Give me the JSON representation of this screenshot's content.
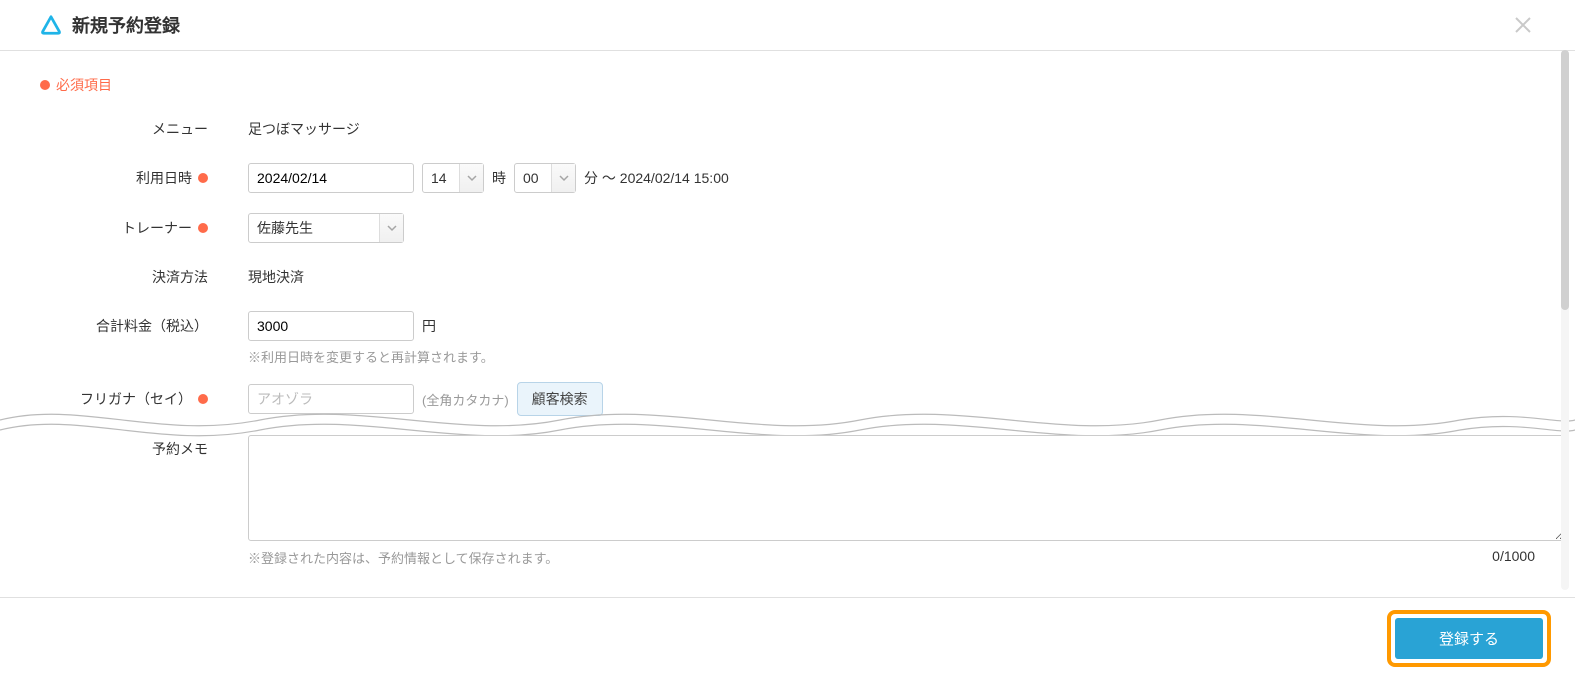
{
  "header": {
    "title": "新規予約登録"
  },
  "legend": {
    "required_label": "必須項目"
  },
  "form": {
    "menu": {
      "label": "メニュー",
      "value": "足つぼマッサージ"
    },
    "datetime": {
      "label": "利用日時",
      "date_value": "2024/02/14",
      "hour_selected": "14",
      "hour_unit": "時",
      "minute_selected": "00",
      "minute_unit_text": "分 〜 2024/02/14 15:00"
    },
    "trainer": {
      "label": "トレーナー",
      "selected": "佐藤先生"
    },
    "payment": {
      "label": "決済方法",
      "value": "現地決済"
    },
    "price": {
      "label": "合計料金（税込）",
      "value": "3000",
      "unit": "円",
      "help": "※利用日時を変更すると再計算されます。"
    },
    "furigana_sei": {
      "label": "フリガナ（セイ）",
      "placeholder": "アオゾラ",
      "hint": "(全角カタカナ)",
      "search_button": "顧客検索"
    },
    "memo": {
      "label": "予約メモ",
      "value": "",
      "help": "※登録された内容は、予約情報として保存されます。",
      "counter": "0/1000"
    }
  },
  "footer": {
    "submit_label": "登録する"
  }
}
